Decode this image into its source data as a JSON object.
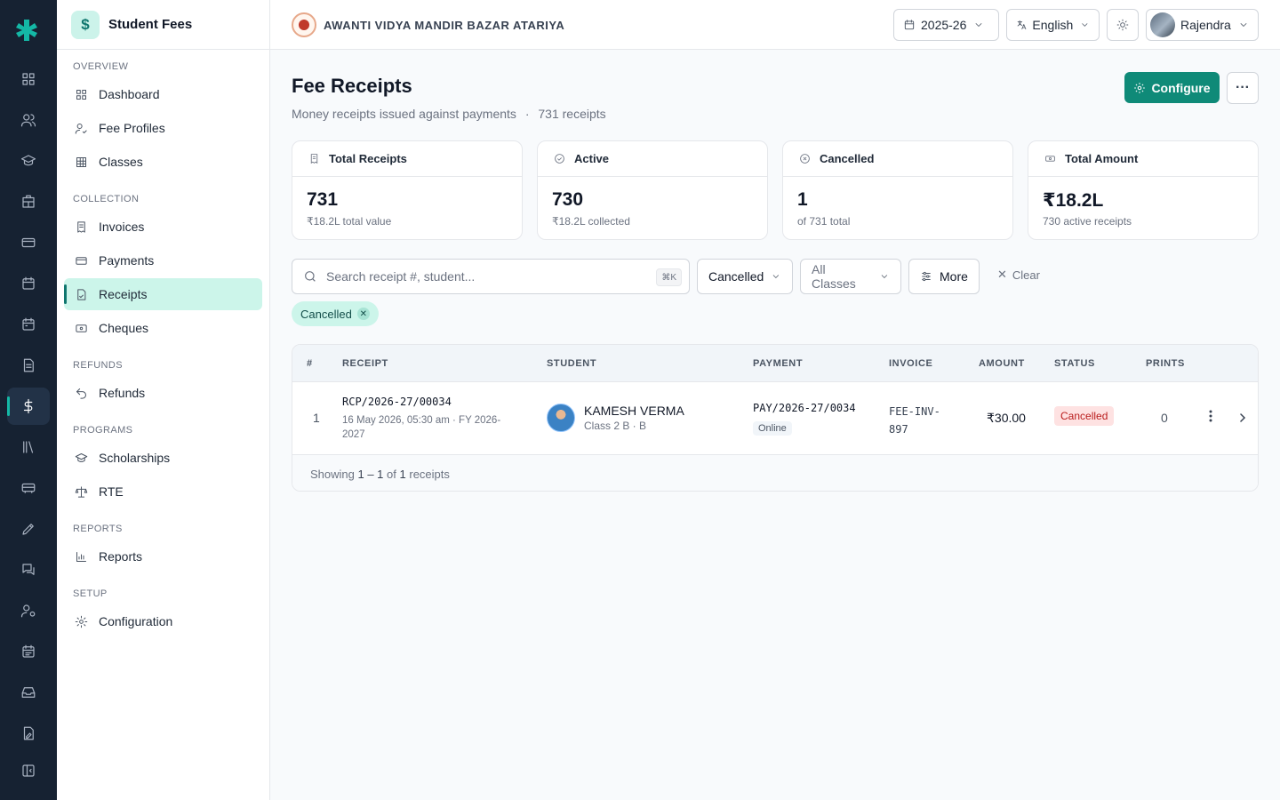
{
  "sidebar": {
    "title": "Student Fees",
    "app_icon": "$",
    "sections": {
      "overview": "OVERVIEW",
      "collection": "COLLECTION",
      "refunds": "REFUNDS",
      "programs": "PROGRAMS",
      "reports": "REPORTS",
      "setup": "SETUP"
    },
    "items": {
      "dashboard": "Dashboard",
      "fee_profiles": "Fee Profiles",
      "classes": "Classes",
      "invoices": "Invoices",
      "payments": "Payments",
      "receipts": "Receipts",
      "cheques": "Cheques",
      "refunds": "Refunds",
      "scholarships": "Scholarships",
      "rte": "RTE",
      "reports": "Reports",
      "configuration": "Configuration"
    }
  },
  "topbar": {
    "school_name": "AWANTI VIDYA MANDIR BAZAR ATARIYA",
    "year": "2025-26",
    "language": "English",
    "user": "Rajendra"
  },
  "page": {
    "title": "Fee Receipts",
    "subtitle": "Money receipts issued against payments",
    "dot": "·",
    "count": "731 receipts",
    "configure_label": "Configure",
    "more_label": "···"
  },
  "stats": {
    "total": {
      "label": "Total Receipts",
      "value": "731",
      "note": "₹18.2L total value"
    },
    "active": {
      "label": "Active",
      "value": "730",
      "note": "₹18.2L collected"
    },
    "cancelled": {
      "label": "Cancelled",
      "value": "1",
      "note": "of 731 total"
    },
    "amount": {
      "label": "Total Amount",
      "value": "₹18.2L",
      "note": "730 active receipts"
    }
  },
  "filters": {
    "search_placeholder": "Search receipt #, student...",
    "shortcut": "⌘K",
    "status": "Cancelled",
    "classes": "All Classes",
    "more": "More",
    "clear": "Clear",
    "active_chip": "Cancelled"
  },
  "table": {
    "headers": {
      "num": "#",
      "receipt": "RECEIPT",
      "student": "STUDENT",
      "payment": "PAYMENT",
      "invoice": "INVOICE",
      "amount": "AMOUNT",
      "status": "STATUS",
      "prints": "PRINTS"
    },
    "rows": [
      {
        "num": "1",
        "receipt_no": "RCP/2026-27/00034",
        "receipt_meta_1": "16 May 2026, 05:30 am · FY 2026-",
        "receipt_meta_2": "2027",
        "student_name": "KAMESH VERMA",
        "student_class": "Class 2 B · B",
        "payment_no": "PAY/2026-27/0034",
        "payment_mode": "Online",
        "invoice_1": "FEE-INV-",
        "invoice_2": "897",
        "amount": "₹30.00",
        "status": "Cancelled",
        "prints": "0"
      }
    ],
    "footer": {
      "prefix": "Showing",
      "range": "1 – 1",
      "of": "of",
      "total": "1",
      "suffix": "receipts"
    }
  },
  "colors": {
    "rail_bg": "#162232",
    "accent": "#0f8a78",
    "active_bg": "#ccf5ea",
    "cancel_bg": "#fee2e2",
    "cancel_fg": "#b91c1c"
  }
}
